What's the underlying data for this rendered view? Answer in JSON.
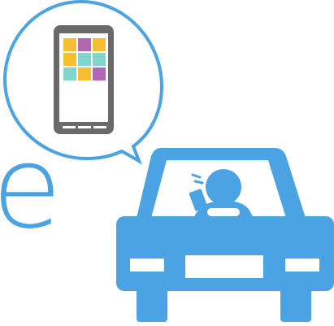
{
  "partial_text": "e",
  "colors": {
    "accent": "#4aa3e3",
    "phone_body": "#6a6a6a",
    "screen": "#ffffff",
    "tile_yellow": "#f7bf2f",
    "tile_purple": "#b267b2",
    "tile_teal": "#7fd6cc",
    "bubble_stroke": "#4aa3e3",
    "background": "#ffffff"
  },
  "icons": [
    "speech-bubble-icon",
    "smartphone-icon",
    "car-icon",
    "driver-icon",
    "phone-in-hand-icon",
    "steering-wheel-icon"
  ]
}
